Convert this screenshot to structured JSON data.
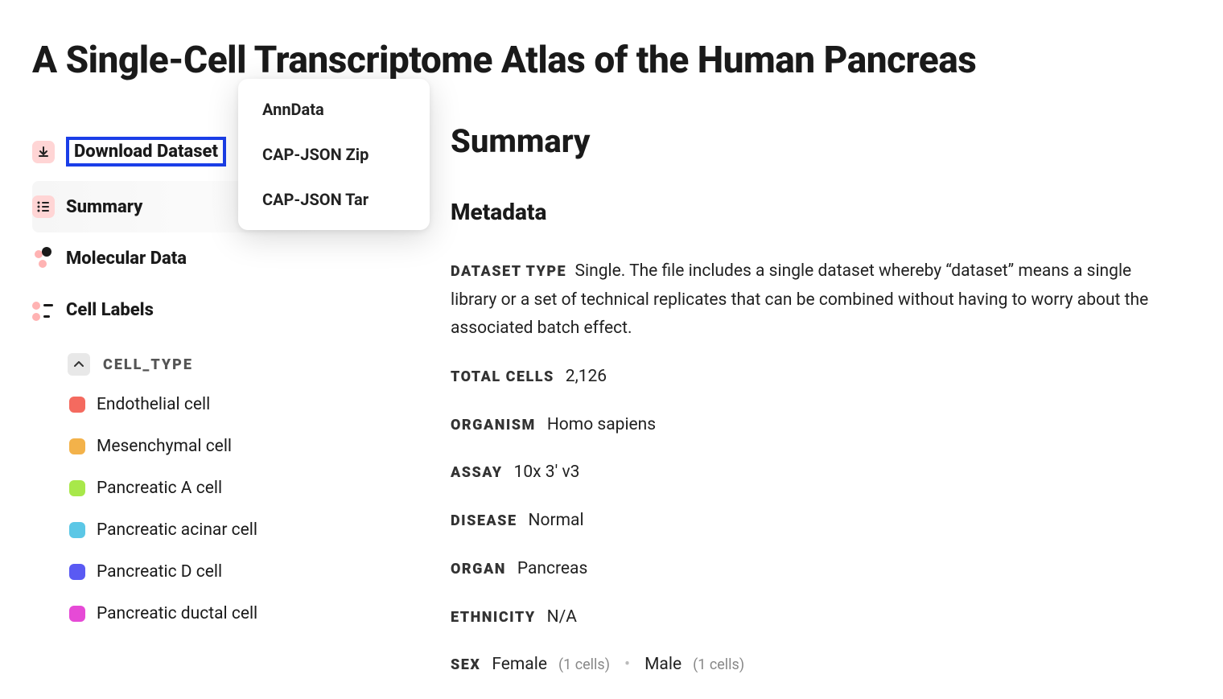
{
  "title": "A Single-Cell Transcriptome Atlas of the Human Pancreas",
  "sidebar": {
    "download": "Download Dataset",
    "summary": "Summary",
    "molecular": "Molecular Data",
    "celllabels": "Cell Labels"
  },
  "dropdown": {
    "anndata": "AnnData",
    "capjson_zip": "CAP-JSON Zip",
    "capjson_tar": "CAP-JSON Tar"
  },
  "cellgroup": {
    "name": "CELL_TYPE",
    "items": [
      {
        "label": "Endothelial cell",
        "color": "#f46a5f"
      },
      {
        "label": "Mesenchymal cell",
        "color": "#f3b24a"
      },
      {
        "label": "Pancreatic A cell",
        "color": "#a8e84a"
      },
      {
        "label": "Pancreatic acinar cell",
        "color": "#5bc7e6"
      },
      {
        "label": "Pancreatic D cell",
        "color": "#5a5af3"
      },
      {
        "label": "Pancreatic ductal cell",
        "color": "#e64ad6"
      }
    ]
  },
  "summary": {
    "heading": "Summary",
    "metadata_heading": "Metadata",
    "dataset_type_key": "DATASET TYPE",
    "dataset_type_val": "Single. The file includes a single dataset whereby “dataset” means a single library or a set of technical replicates that can be combined without having to worry about the associated batch effect.",
    "total_cells_key": "TOTAL CELLS",
    "total_cells_val": "2,126",
    "organism_key": "ORGANISM",
    "organism_val": "Homo sapiens",
    "assay_key": "ASSAY",
    "assay_val": "10x 3' v3",
    "disease_key": "DISEASE",
    "disease_val": "Normal",
    "organ_key": "ORGAN",
    "organ_val": "Pancreas",
    "ethnicity_key": "ETHNICITY",
    "ethnicity_val": "N/A",
    "sex_key": "SEX",
    "sex_female": "Female",
    "sex_female_count": "(1 cells)",
    "sex_male": "Male",
    "sex_male_count": "(1 cells)"
  }
}
